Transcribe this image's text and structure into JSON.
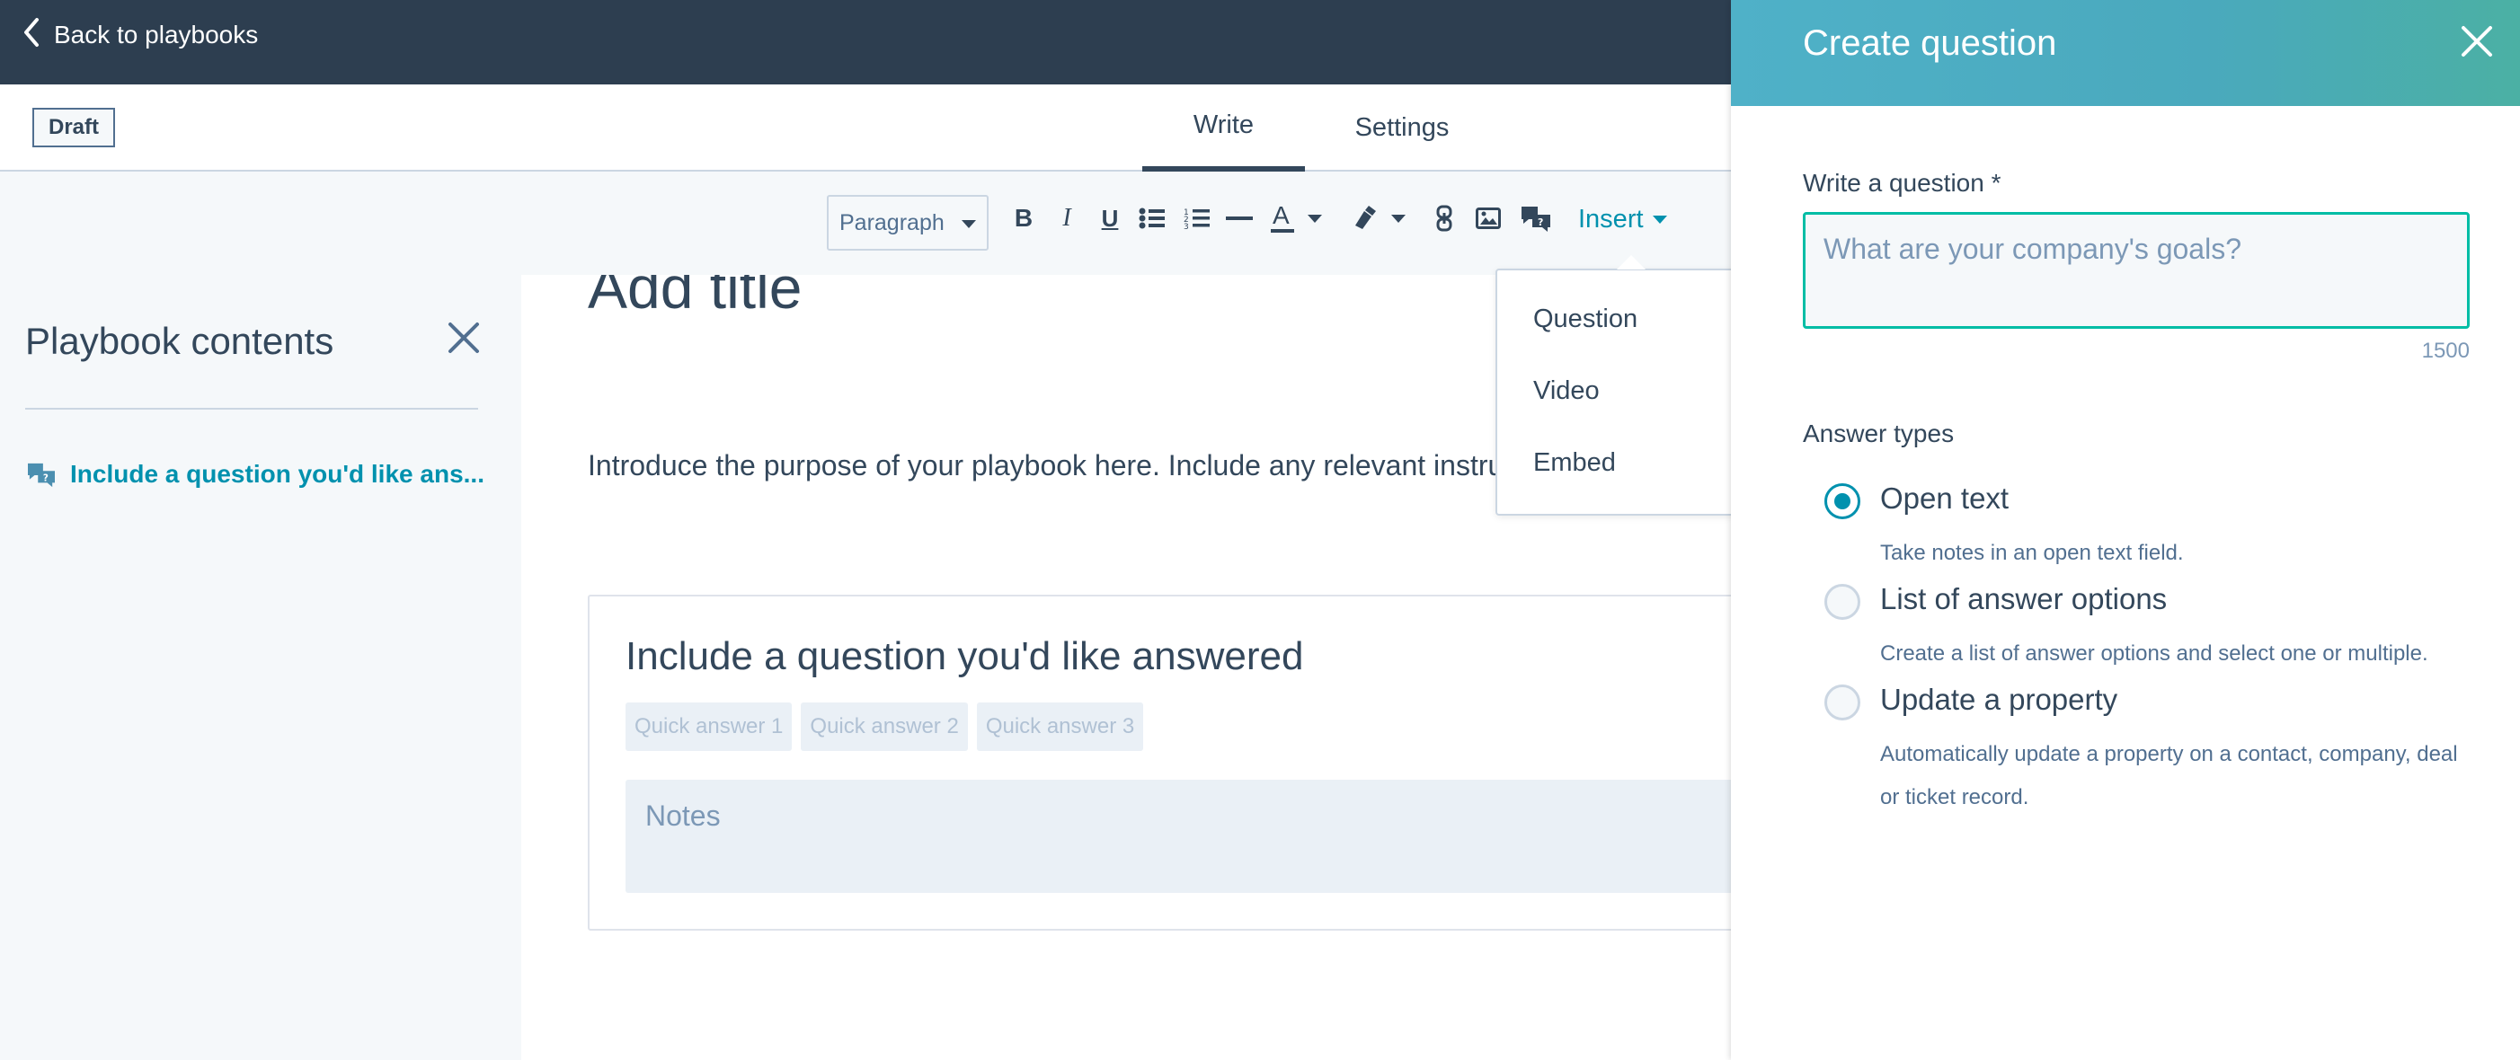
{
  "topbar": {
    "back_label": "Back to playbooks"
  },
  "tabsbar": {
    "status_badge": "Draft",
    "tabs": [
      {
        "label": "Write",
        "active": true
      },
      {
        "label": "Settings",
        "active": false
      }
    ]
  },
  "toolbar": {
    "paragraph_select": "Paragraph",
    "insert_label": "Insert",
    "buttons": [
      "bold-icon",
      "italic-icon",
      "underline-icon",
      "bulleted-list-icon",
      "numbered-list-icon",
      "horizontal-rule-icon",
      "text-color-icon",
      "highlight-icon",
      "link-icon",
      "image-icon",
      "question-icon"
    ]
  },
  "sidebar": {
    "title": "Playbook contents",
    "items": [
      {
        "label": "Include a question you'd like ans..."
      }
    ]
  },
  "editor": {
    "title_placeholder": "Add title",
    "intro_text": "Introduce the purpose of your playbook here. Include any relevant instru",
    "question_card": {
      "title": "Include a question you'd like answered",
      "quick_answers": [
        "Quick answer 1",
        "Quick answer 2",
        "Quick answer 3"
      ],
      "notes_placeholder": "Notes"
    }
  },
  "insert_menu": {
    "items": [
      "Question",
      "Video",
      "Embed"
    ]
  },
  "panel": {
    "title": "Create question",
    "question_label": "Write a question *",
    "question_placeholder": "What are your company's goals?",
    "char_count": "1500",
    "answer_types_label": "Answer types",
    "options": [
      {
        "title": "Open text",
        "description": "Take notes in an open text field.",
        "selected": true
      },
      {
        "title": "List of answer options",
        "description": "Create a list of answer options and select one or multiple.",
        "selected": false
      },
      {
        "title": "Update a property",
        "description": "Automatically update a property on a contact, company, deal or ticket record.",
        "selected": false
      }
    ]
  },
  "colors": {
    "navy": "#2d3e50",
    "teal": "#0091ae",
    "text": "#33475b",
    "panel_header": "#4fb1c8",
    "focus_border": "#00bda5"
  }
}
